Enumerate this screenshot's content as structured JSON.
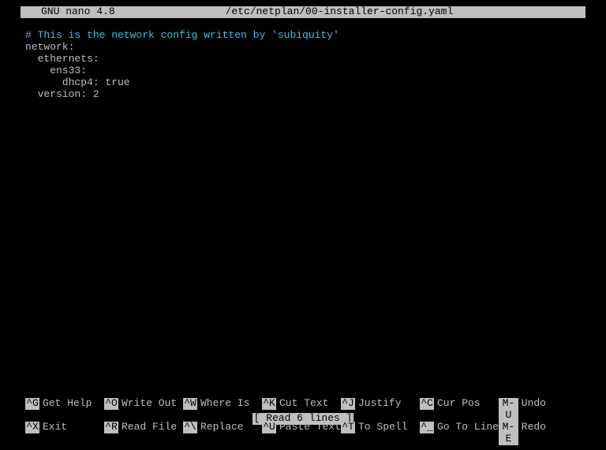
{
  "title": {
    "app": "GNU nano 4.8",
    "file": "/etc/netplan/00-installer-config.yaml"
  },
  "editor": {
    "comment": "# This is the network config written by 'subiquity'",
    "lines": [
      "network:",
      "  ethernets:",
      "    ens33:",
      "      dhcp4: true",
      "  version: 2"
    ]
  },
  "status": {
    "message": "[ Read 6 lines ]"
  },
  "shortcuts": {
    "row1": [
      {
        "key": "^G",
        "label": "Get Help"
      },
      {
        "key": "^O",
        "label": "Write Out"
      },
      {
        "key": "^W",
        "label": "Where Is"
      },
      {
        "key": "^K",
        "label": "Cut Text"
      },
      {
        "key": "^J",
        "label": "Justify"
      },
      {
        "key": "^C",
        "label": "Cur Pos"
      },
      {
        "key": "M-U",
        "label": "Undo"
      }
    ],
    "row2": [
      {
        "key": "^X",
        "label": "Exit"
      },
      {
        "key": "^R",
        "label": "Read File"
      },
      {
        "key": "^\\",
        "label": "Replace"
      },
      {
        "key": "^U",
        "label": "Paste Text"
      },
      {
        "key": "^T",
        "label": "To Spell"
      },
      {
        "key": "^_",
        "label": "Go To Line"
      },
      {
        "key": "M-E",
        "label": "Redo"
      }
    ]
  }
}
